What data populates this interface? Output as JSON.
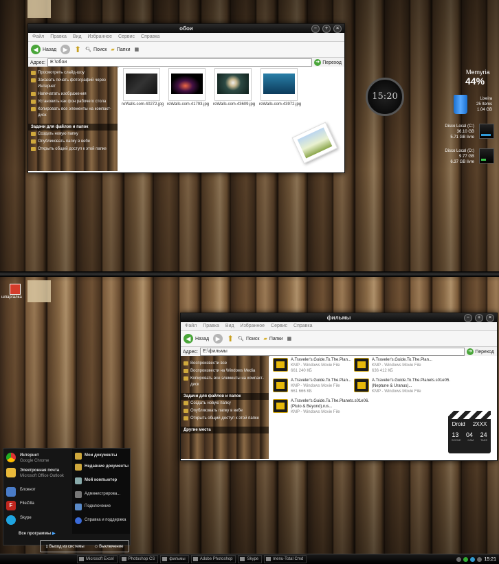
{
  "desktop_top": {
    "window": {
      "title": "обои",
      "menu": [
        "Файл",
        "Правка",
        "Вид",
        "Избранное",
        "Сервис",
        "Справка"
      ],
      "toolbar": {
        "back": "Назад",
        "search": "Поиск",
        "folders": "Папки"
      },
      "address_label": "Адрес:",
      "address_value": "E:\\обои",
      "go_label": "Переход",
      "sidebar": {
        "section1_items": [
          "Просмотреть слайд-шоу",
          "Заказать печать фотографий через Интернет",
          "Напечатать изображения",
          "Установить как фон рабочего стола",
          "Копировать все элементы на компакт-диск"
        ],
        "section2_header": "Задачи для файлов и папок",
        "section2_items": [
          "Создать новую папку",
          "Опубликовать папку в вебе",
          "Открыть общий доступ к этой папке"
        ]
      },
      "files": [
        "reWalls.com-40272.jpg",
        "reWalls.com-41793.jpg",
        "reWalls.com-43609.jpg",
        "reWalls.com-43972.jpg"
      ]
    },
    "clock": "15:20",
    "memory": {
      "label": "Memyria",
      "value": "44%"
    },
    "recycle": {
      "name": "Lixeira",
      "items": "25 Items",
      "size": "1.04 GB"
    },
    "disks": [
      {
        "name": "Disco Local (C:)",
        "total": "36.10 GB",
        "free": "5.71 GB livre"
      },
      {
        "name": "Disco Local (D:)",
        "total": "9.77 GB",
        "free": "6.37 GB livre"
      }
    ]
  },
  "desktop_bottom": {
    "desktop_icon_label": "шпаргалка",
    "window": {
      "title": "фильмы",
      "menu": [
        "Файл",
        "Правка",
        "Вид",
        "Избранное",
        "Сервис",
        "Справка"
      ],
      "toolbar": {
        "back": "Назад",
        "search": "Поиск",
        "folders": "Папки"
      },
      "address_label": "Адрес:",
      "address_value": "E:\\фильмы",
      "go_label": "Переход",
      "sidebar": {
        "section1_items": [
          "Воспроизвести все",
          "Воспроизвести на Windows Media",
          "Копировать все элементы на компакт-диск"
        ],
        "section2_header": "Задачи для файлов и папок",
        "section2_items": [
          "Создать новую папку",
          "Опубликовать папку в вебе",
          "Открыть общий доступ к этой папке"
        ],
        "section3_header": "Другие места"
      },
      "files": [
        {
          "title": "A.Traveler's.Guide.To.The.Plan...",
          "type": "KMP - Windows Movie File",
          "size": "661 240 КБ"
        },
        {
          "title": "A.Traveler's.Guide.To.The.Plan...",
          "type": "KMP - Windows Movie File",
          "size": "636 412 КБ"
        },
        {
          "title": "A.Traveler's.Guide.To.The.Plan...",
          "type": "KMP - Windows Movie File",
          "size": "661 666 КБ"
        },
        {
          "title": "A.Traveler's.Guide.To.The.Planets.s01e05.(Neptune & Uranus)...",
          "type": "KMP - Windows Movie File",
          "size": ""
        },
        {
          "title": "A.Traveler's.Guide.To.The.Planets.s01e06.(Pluto & Beyond).rus...",
          "type": "KMP - Windows Movie File",
          "size": ""
        }
      ]
    },
    "slate": {
      "name": "Droid",
      "code": "2XXX",
      "scene": "13",
      "cam": "04",
      "take": "24",
      "scene_lbl": "SCENE",
      "cam_lbl": "CAM",
      "take_lbl": "TAKE"
    },
    "start_menu": {
      "pinned": [
        {
          "title": "Интернет",
          "sub": "Google Chrome"
        },
        {
          "title": "Электронная почта",
          "sub": "Microsoft Office Outlook"
        },
        {
          "title": "Блокнот",
          "sub": ""
        },
        {
          "title": "FileZilla",
          "sub": ""
        },
        {
          "title": "Skype",
          "sub": ""
        }
      ],
      "all_programs": "Все программы",
      "right": [
        "Мои документы",
        "Недавние документы",
        "Мой компьютер",
        "Администрирова...",
        "Подключение",
        "Справка и поддержка"
      ],
      "logout": "Выход из системы",
      "shutdown": "Выключение"
    },
    "taskbar": {
      "tasks": [
        "Microsoft Excel",
        "Photoshop CS",
        "фильмы",
        "Adobe Photoshop",
        "Skype",
        "menu-Total Cmd"
      ],
      "time": "15:21"
    }
  }
}
